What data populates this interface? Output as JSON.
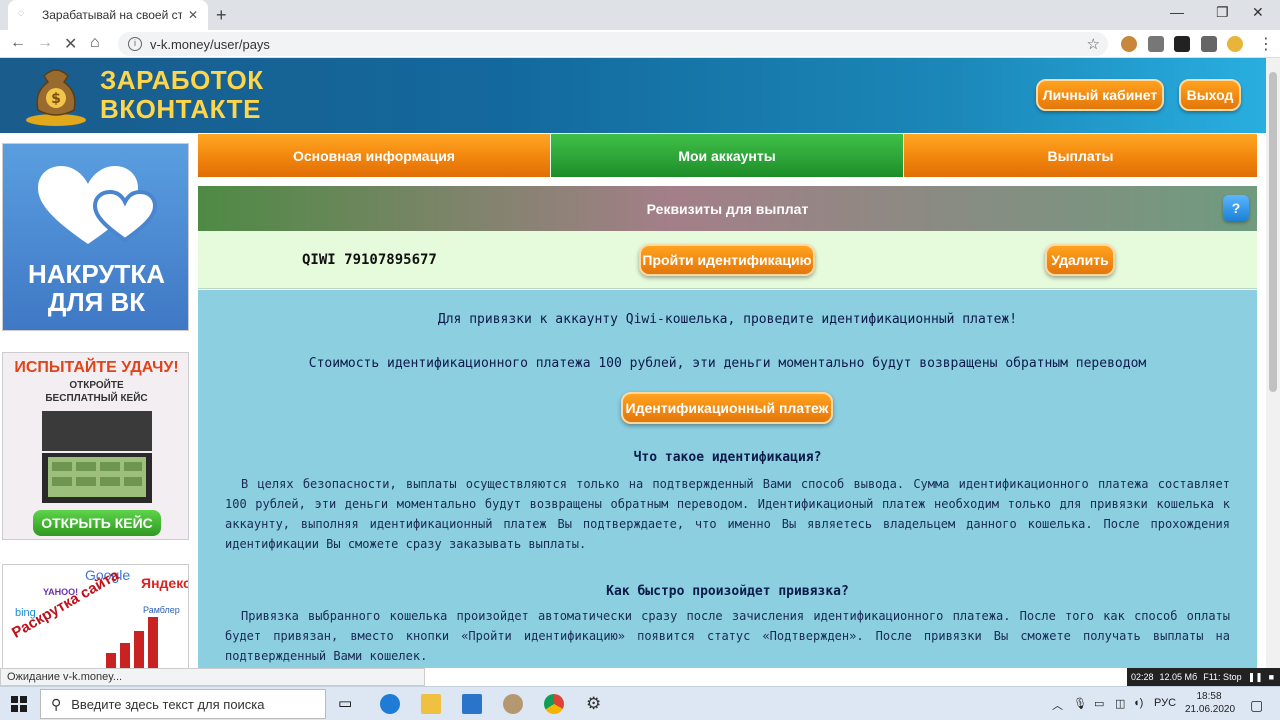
{
  "browser": {
    "tab_title": "Зарабатывай на своей страниц",
    "url": "v-k.money/user/pays",
    "status_text": "Ожидание v-k.money..."
  },
  "header": {
    "logo_line1": "ЗАРАБОТОК",
    "logo_line2": "ВКОНТАКТЕ",
    "cabinet_label": "Личный кабинет",
    "logout_label": "Выход"
  },
  "ads": {
    "ad1_line1": "НАКРУТКА",
    "ad1_line2": "ДЛЯ ВК",
    "ad2_title": "ИСПЫТАЙТЕ УДАЧУ!",
    "ad2_sub1": "ОТКРОЙТЕ",
    "ad2_sub2": "БЕСПЛАТНЫЙ КЕЙС",
    "ad2_btn": "ОТКРЫТЬ КЕЙС",
    "ad3_google": "Google",
    "ad3_yandex": "Яндекс",
    "ad3_yahoo": "YAHOO!",
    "ad3_bing": "bing",
    "ad3_rambler": "Рамблер",
    "ad3_promo": "Раскрутка сайта"
  },
  "nav": {
    "tab1": "Основная информация",
    "tab2": "Мои аккаунты",
    "tab3": "Выплаты"
  },
  "panel": {
    "title": "Реквизиты для выплат",
    "help": "?",
    "requisite": "QIWI 79107895677",
    "identify_label": "Пройти идентификацию",
    "delete_label": "Удалить",
    "line1": "Для привязки к аккаунту Qiwi-кошелька, проведите идентификационный платеж!",
    "line2": "Стоимость идентификационного платежа 100 рублей, эти деньги моментально будут возвращены обратным переводом",
    "pay_label": "Идентификационный платеж",
    "h1": "Что такое идентификация?",
    "p1": "В целях безопасности, выплаты осуществляются только на подтвержденный Вами способ вывода. Сумма идентификационного платежа составляет 100 рублей, эти деньги моментально будут возвращены обратным переводом. Идентификационый платеж необходим только для привязки кошелька к аккаунту, выполняя идентификационный платеж Вы подтверждаете, что именно Вы являетесь владельцем данного кошелька. После прохождения идентификации Вы сможете сразу заказывать выплаты.",
    "h2": "Как быстро произойдет привязка?",
    "p2": "Привязка выбранного кошелька произойдет автоматически сразу после зачисления идентификационного платежа. После того как способ оплаты будет привязан, вместо кнопки «Пройти идентификацию» появится статус «Подтвержден». После привязки Вы сможете получать выплаты на подтвержденный Вами кошелек."
  },
  "recorder": {
    "time": "02:28",
    "size": "12.05 Мб",
    "hotkey": "F11: Stop"
  },
  "taskbar": {
    "search_placeholder": "Введите здесь текст для поиска",
    "lang": "РУС",
    "time": "18:58",
    "date": "21.06.2020"
  },
  "colors": {
    "accent_orange": "#f08a14",
    "nav_green": "#2fa83a",
    "info_bg": "#8bcfe0",
    "logo_yellow": "#ffd54a"
  }
}
